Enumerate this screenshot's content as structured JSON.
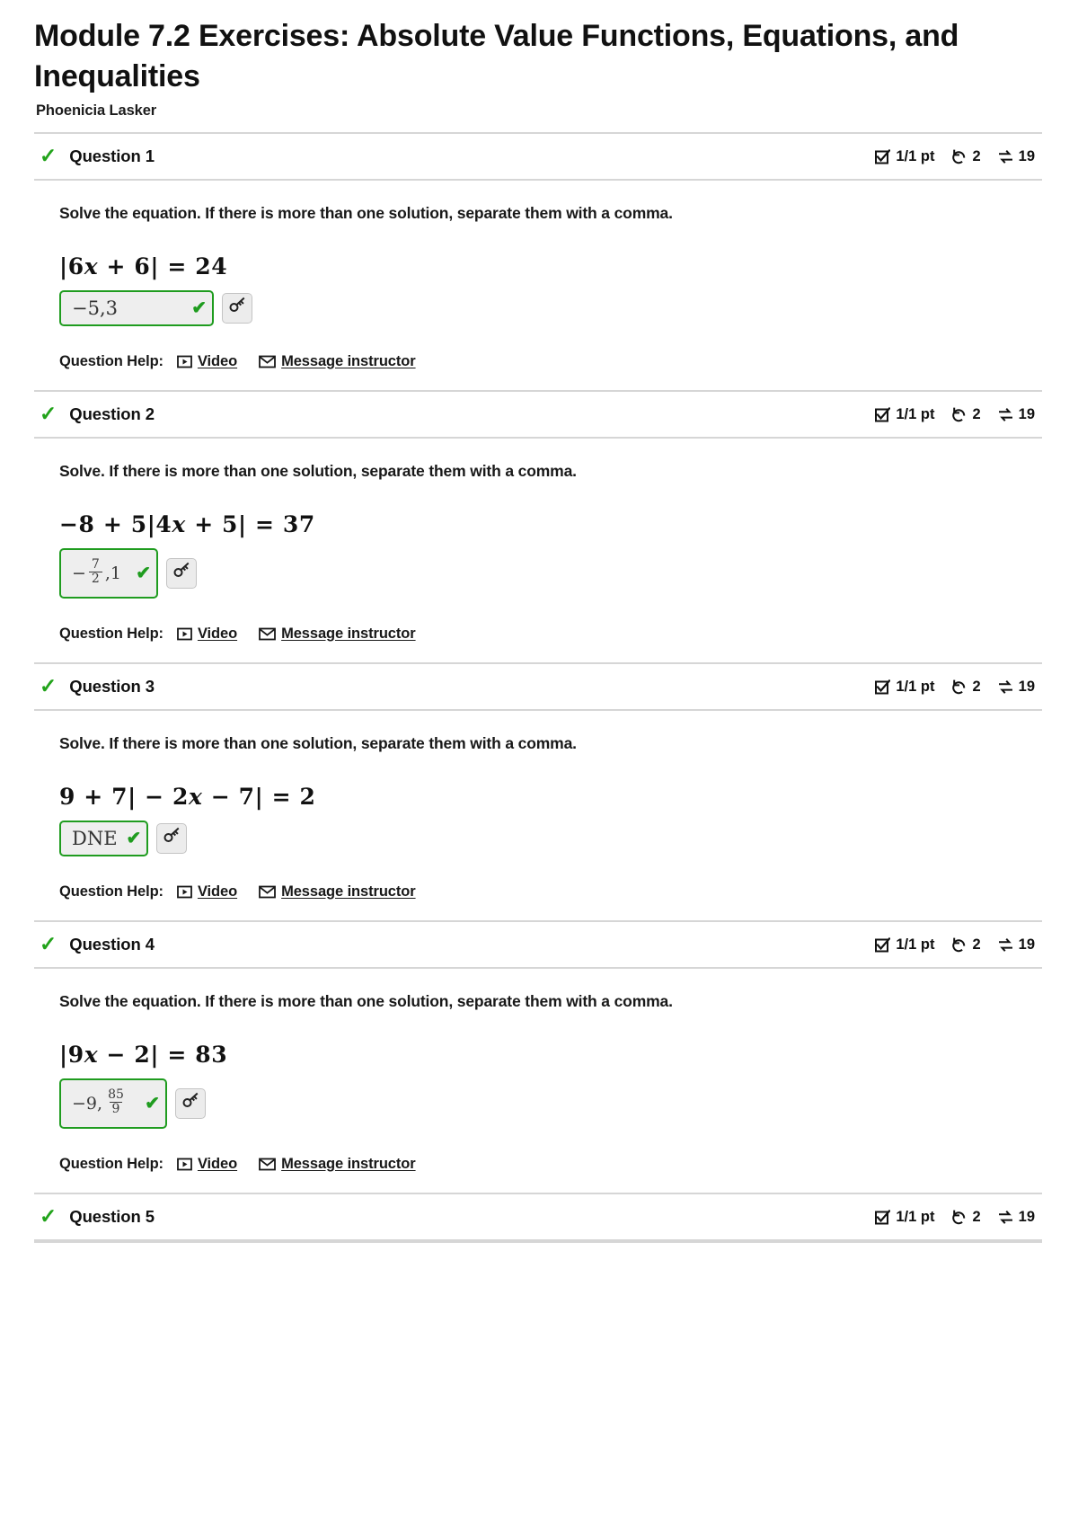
{
  "header": {
    "title": "Module 7.2 Exercises: Absolute Value Functions, Equations, and Inequalities",
    "student": "Phoenicia Lasker"
  },
  "icons": {
    "status_check": "✓",
    "answer_check": "✔",
    "score_icon": "checkbox-checked-icon",
    "attempts_icon": "undo-arrow-icon",
    "retry_icon": "refresh-arrows-icon",
    "tool_icon": "key-icon",
    "video_icon": "video-play-icon",
    "message_icon": "envelope-icon"
  },
  "colors": {
    "correct_green": "#1f9c1f",
    "check_green": "#22a31b",
    "rule_gray": "#d6d6d6",
    "field_bg": "#eeeeee",
    "button_bg": "#ececec"
  },
  "help": {
    "label": "Question Help:",
    "video_label": "Video",
    "message_label": "Message instructor"
  },
  "questions": [
    {
      "label": "Question 1",
      "score": "1/1 pt",
      "attempts": "2",
      "retries": "19",
      "prompt": "Solve the equation. If there is more than one solution, separate them with a comma.",
      "equation": "|6x + 6| = 24",
      "equation_parts": {
        "lead": "|6",
        "var": "x",
        "tail": " + 6| = 24"
      },
      "answer": "−5,3",
      "answer_type": "plain"
    },
    {
      "label": "Question 2",
      "score": "1/1 pt",
      "attempts": "2",
      "retries": "19",
      "prompt": "Solve. If there is more than one solution, separate them with a comma.",
      "equation": "−8 + 5|4x + 5| = 37",
      "equation_parts": {
        "lead": "−8 + 5|4",
        "var": "x",
        "tail": " + 5| = 37"
      },
      "answer": "− 7/2 ,1",
      "answer_type": "fraction",
      "answer_prefix": "−",
      "answer_numerator": "7",
      "answer_denominator": "2",
      "answer_suffix": ",1"
    },
    {
      "label": "Question 3",
      "score": "1/1 pt",
      "attempts": "2",
      "retries": "19",
      "prompt": "Solve. If there is more than one solution, separate them with a comma.",
      "equation": "9 + 7| − 2x − 7| = 2",
      "equation_parts": {
        "lead": "9 + 7| − 2",
        "var": "x",
        "tail": " − 7| = 2"
      },
      "answer": "DNE",
      "answer_type": "plain"
    },
    {
      "label": "Question 4",
      "score": "1/1 pt",
      "attempts": "2",
      "retries": "19",
      "prompt": "Solve the equation. If there is more than one solution, separate them with a comma.",
      "equation": "|9x − 2| = 83",
      "equation_parts": {
        "lead": "|9",
        "var": "x",
        "tail": " − 2| = 83"
      },
      "answer": "−9, 85/9",
      "answer_type": "fraction",
      "answer_prefix": "−9,",
      "answer_numerator": "85",
      "answer_denominator": "9",
      "answer_suffix": ""
    },
    {
      "label": "Question 5",
      "score": "1/1 pt",
      "attempts": "2",
      "retries": "19"
    }
  ]
}
